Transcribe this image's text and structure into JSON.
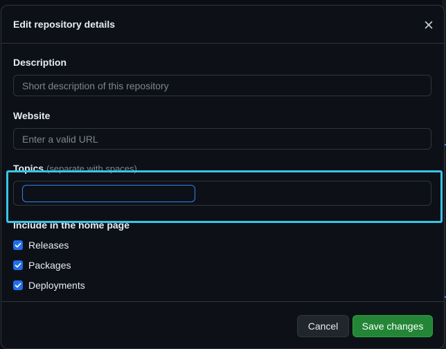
{
  "dialog": {
    "title": "Edit repository details",
    "close_icon": "close-icon"
  },
  "description": {
    "label": "Description",
    "placeholder": "Short description of this repository",
    "value": ""
  },
  "website": {
    "label": "Website",
    "placeholder": "Enter a valid URL",
    "value": ""
  },
  "topics": {
    "label": "Topics",
    "hint": "(separate with spaces)",
    "value": ""
  },
  "home_page": {
    "label": "Include in the home page",
    "options": [
      {
        "label": "Releases",
        "checked": true
      },
      {
        "label": "Packages",
        "checked": true
      },
      {
        "label": "Deployments",
        "checked": true
      }
    ]
  },
  "footer": {
    "cancel_label": "Cancel",
    "save_label": "Save changes"
  },
  "colors": {
    "background": "#0d1117",
    "border": "#30363d",
    "accent": "#1f6feb",
    "save": "#238636",
    "highlight": "#39c5e8"
  }
}
